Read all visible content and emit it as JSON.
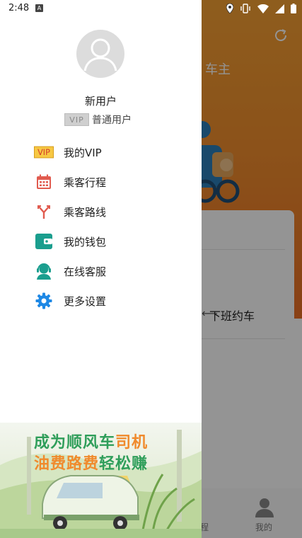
{
  "status_bar": {
    "time": "2:48",
    "notif_badge": "A"
  },
  "background_app": {
    "title_fragment": "车主",
    "card_option": "下班约车",
    "card_mark": "⟵",
    "nav_left_fragment": "程",
    "nav_right_label": "我的"
  },
  "drawer": {
    "user": {
      "name": "新用户",
      "vip_badge": "VIP",
      "type": "普通用户"
    },
    "menu": [
      {
        "label": "我的VIP",
        "icon": "vip-icon"
      },
      {
        "label": "乘客行程",
        "icon": "calendar-icon"
      },
      {
        "label": "乘客路线",
        "icon": "route-fork-icon"
      },
      {
        "label": "我的钱包",
        "icon": "wallet-icon"
      },
      {
        "label": "在线客服",
        "icon": "customer-service-icon"
      },
      {
        "label": "更多设置",
        "icon": "gear-icon"
      }
    ],
    "banner": {
      "line1_a": "成为顺风车",
      "line1_b": "司机",
      "line2_a": "油费路费",
      "line2_b": "轻松赚"
    }
  },
  "colors": {
    "accent_orange": "#f08a2c",
    "accent_green": "#2f9e5a",
    "icon_blue": "#1e88e5",
    "icon_teal": "#1a9e8e",
    "icon_red": "#e15b4f"
  }
}
